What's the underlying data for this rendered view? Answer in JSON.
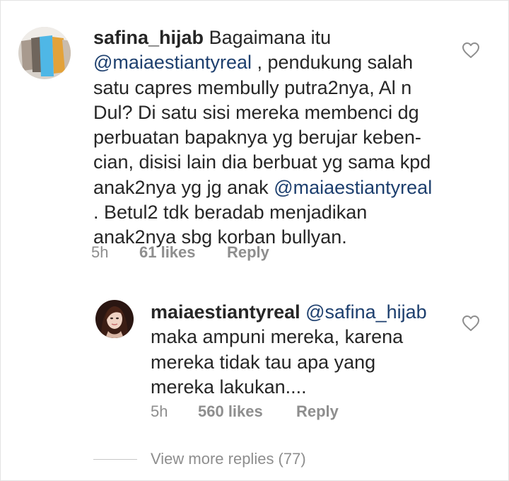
{
  "comment": {
    "username": "safina_hijab",
    "lines": [
      {
        "text": "Bagaimana itu"
      },
      {
        "mention": "@maiaestiantyreal",
        "after": " , pendukung salah"
      },
      {
        "text": "satu capres membully putra2nya, Al n"
      },
      {
        "text": "Dul? Di satu sisi mereka membenci dg"
      },
      {
        "text": "perbuatan bapaknya yg berujar keben-"
      },
      {
        "text": "cian, disisi lain dia berbuat yg sama kpd"
      },
      {
        "before": "anak2nya yg jg anak ",
        "mention": "@maiaestiantyreal"
      },
      {
        "text": ". Betul2 tdk beradab menjadikan"
      },
      {
        "text": "anak2nya sbg korban bullyan."
      }
    ],
    "time": "5h",
    "likes": "61 likes",
    "reply_label": "Reply",
    "heart_icon": "heart-outline-icon"
  },
  "reply": {
    "username": "maiaestiantyreal",
    "mention": "@safina_hijab",
    "lines": [
      "maka ampuni mereka, karena",
      "mereka tidak tau apa yang",
      "mereka lakukan...."
    ],
    "time": "5h",
    "likes": "560 likes",
    "reply_label": "Reply",
    "heart_icon": "heart-outline-icon"
  },
  "view_more": "View more replies (77)",
  "colors": {
    "text": "#262626",
    "mention": "#1d3f6e",
    "meta": "#8e8e8e"
  }
}
